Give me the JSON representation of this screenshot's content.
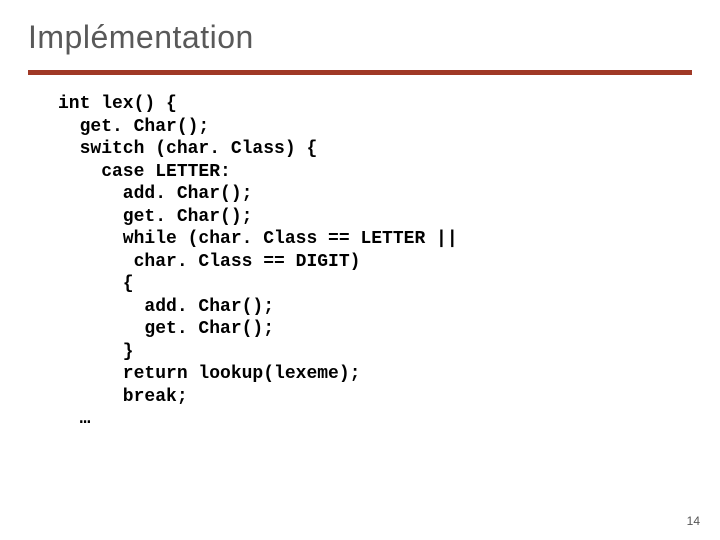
{
  "title": "Implémentation",
  "code": "int lex() {\n  get. Char();\n  switch (char. Class) {\n    case LETTER:\n      add. Char();\n      get. Char();\n      while (char. Class == LETTER ||\n       char. Class == DIGIT)\n      {\n        add. Char();\n        get. Char();\n      }\n      return lookup(lexeme);\n      break;\n  …",
  "page_number": "14"
}
